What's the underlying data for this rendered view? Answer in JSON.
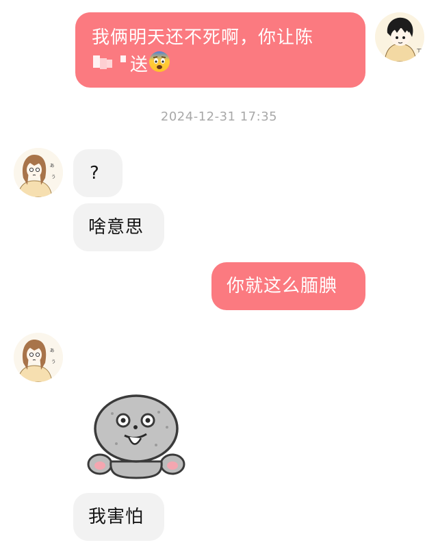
{
  "messages": [
    {
      "sender": "me",
      "text_line1": "我俩明天还不死啊，你让陈",
      "text_line2_suffix": "送",
      "redacted": true,
      "emoji": "fearful-face"
    },
    {
      "sender": "them",
      "text": "?"
    },
    {
      "sender": "them",
      "text": "啥意思"
    },
    {
      "sender": "me",
      "text": "你就这么腼腆"
    },
    {
      "sender": "them",
      "sticker": "gray-blob-sticker"
    },
    {
      "sender": "them",
      "text": "我害怕"
    }
  ],
  "timestamp": "2024-12-31 17:35",
  "colors": {
    "me_bubble": "#fb7a80",
    "them_bubble": "#f2f2f2",
    "timestamp_text": "#a8a8a8"
  },
  "icons": {
    "my_avatar": "anime-boy-avatar",
    "their_avatar": "anime-girl-avatar"
  }
}
